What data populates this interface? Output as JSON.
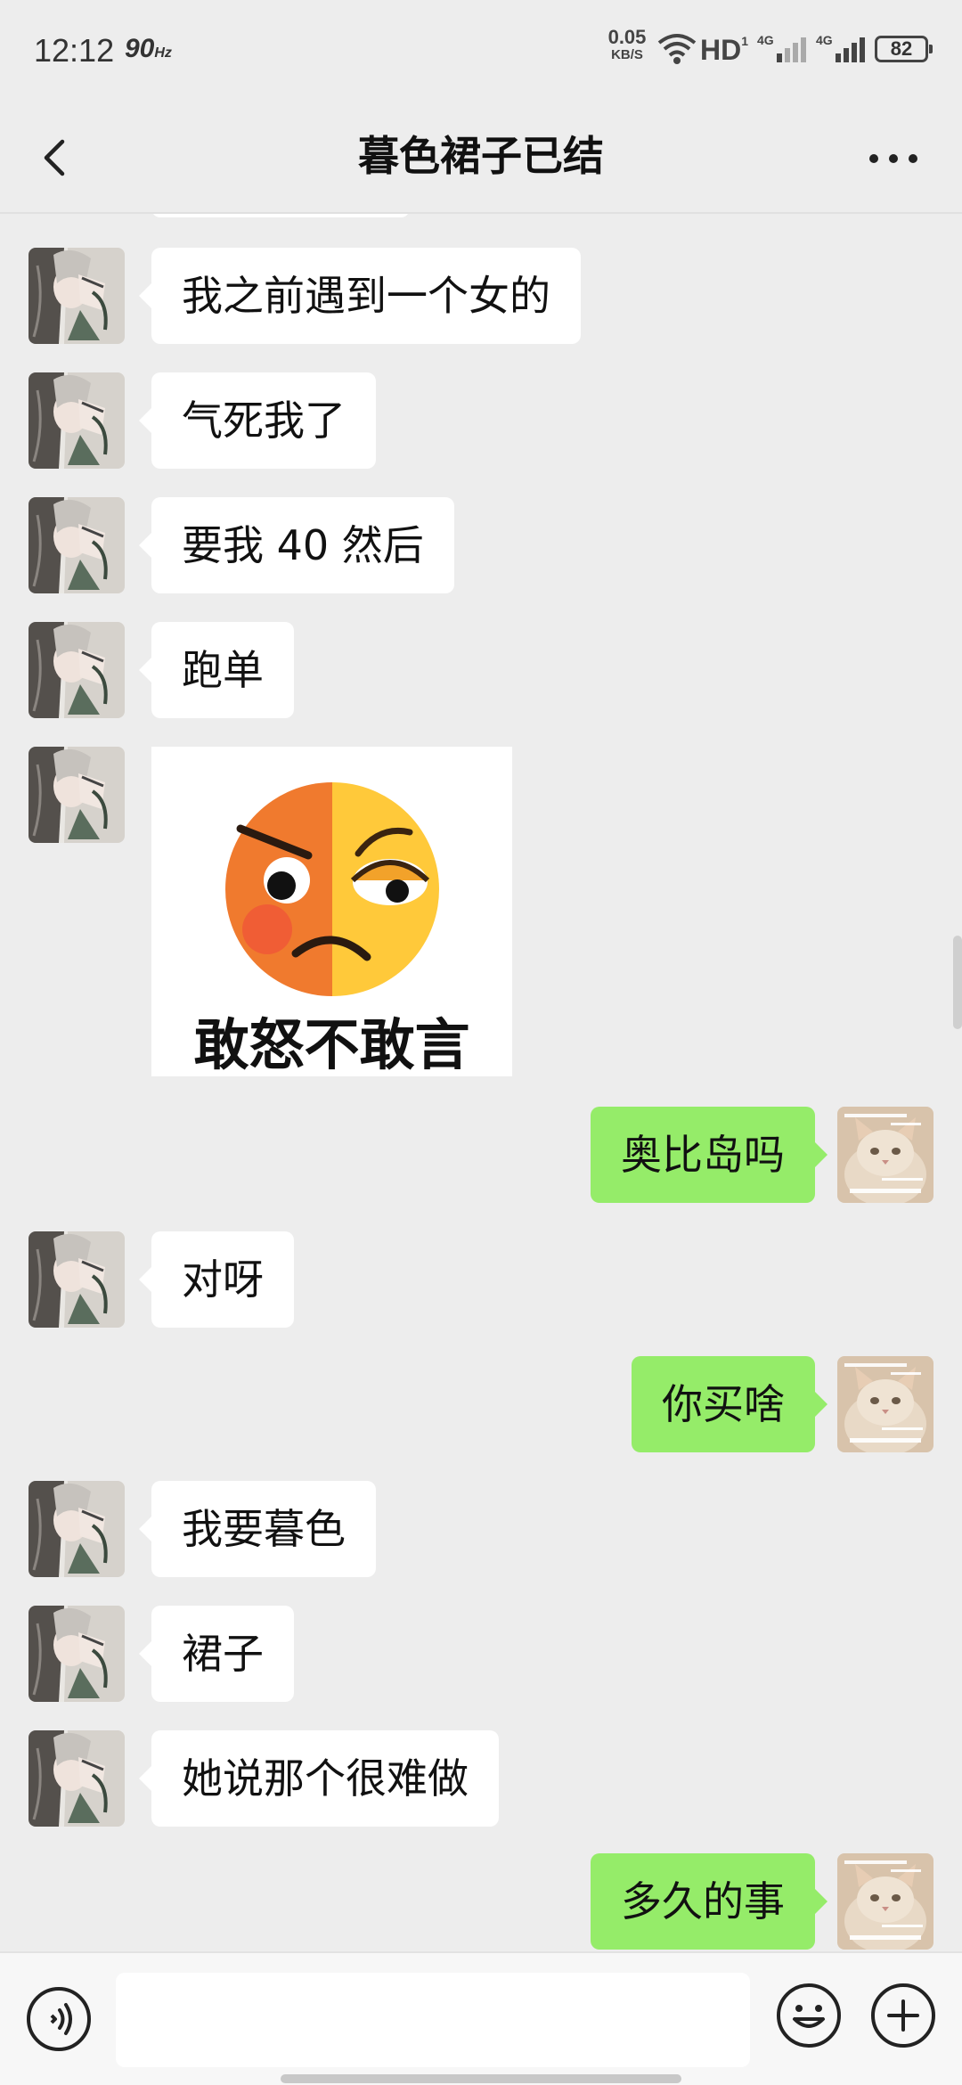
{
  "status_bar": {
    "time": "12:12",
    "refresh_rate": "90",
    "refresh_unit": "Hz",
    "net_speed_value": "0.05",
    "net_speed_unit": "KB/S",
    "hd_label": "HD",
    "battery_level": "82",
    "icons": [
      "wifi-icon",
      "signal-4g-icon",
      "signal-4g-icon",
      "battery-icon"
    ]
  },
  "header": {
    "title": "暮色裙子已结",
    "back_icon": "chevron-left-icon",
    "more_icon": "more-dots-icon"
  },
  "messages": [
    {
      "side": "left",
      "type": "text",
      "text": "我之前遇到一个女的"
    },
    {
      "side": "left",
      "type": "text",
      "text": "气死我了"
    },
    {
      "side": "left",
      "type": "text",
      "text": "要我 40 然后"
    },
    {
      "side": "left",
      "type": "text",
      "text": "跑单"
    },
    {
      "side": "left",
      "type": "sticker",
      "caption": "敢怒不敢言"
    },
    {
      "side": "right",
      "type": "text",
      "text": "奥比岛吗"
    },
    {
      "side": "left",
      "type": "text",
      "text": "对呀"
    },
    {
      "side": "right",
      "type": "text",
      "text": "你买啥"
    },
    {
      "side": "left",
      "type": "text",
      "text": "我要暮色"
    },
    {
      "side": "left",
      "type": "text",
      "text": "裙子"
    },
    {
      "side": "left",
      "type": "text",
      "text": "她说那个很难做"
    },
    {
      "side": "right",
      "type": "text",
      "text": "多久的事"
    }
  ],
  "input_bar": {
    "voice_icon": "voice-icon",
    "input_value": "",
    "emoji_icon": "emoji-icon",
    "plus_icon": "plus-icon"
  },
  "colors": {
    "background": "#ededed",
    "bubble_left": "#ffffff",
    "bubble_right": "#95ec69"
  }
}
